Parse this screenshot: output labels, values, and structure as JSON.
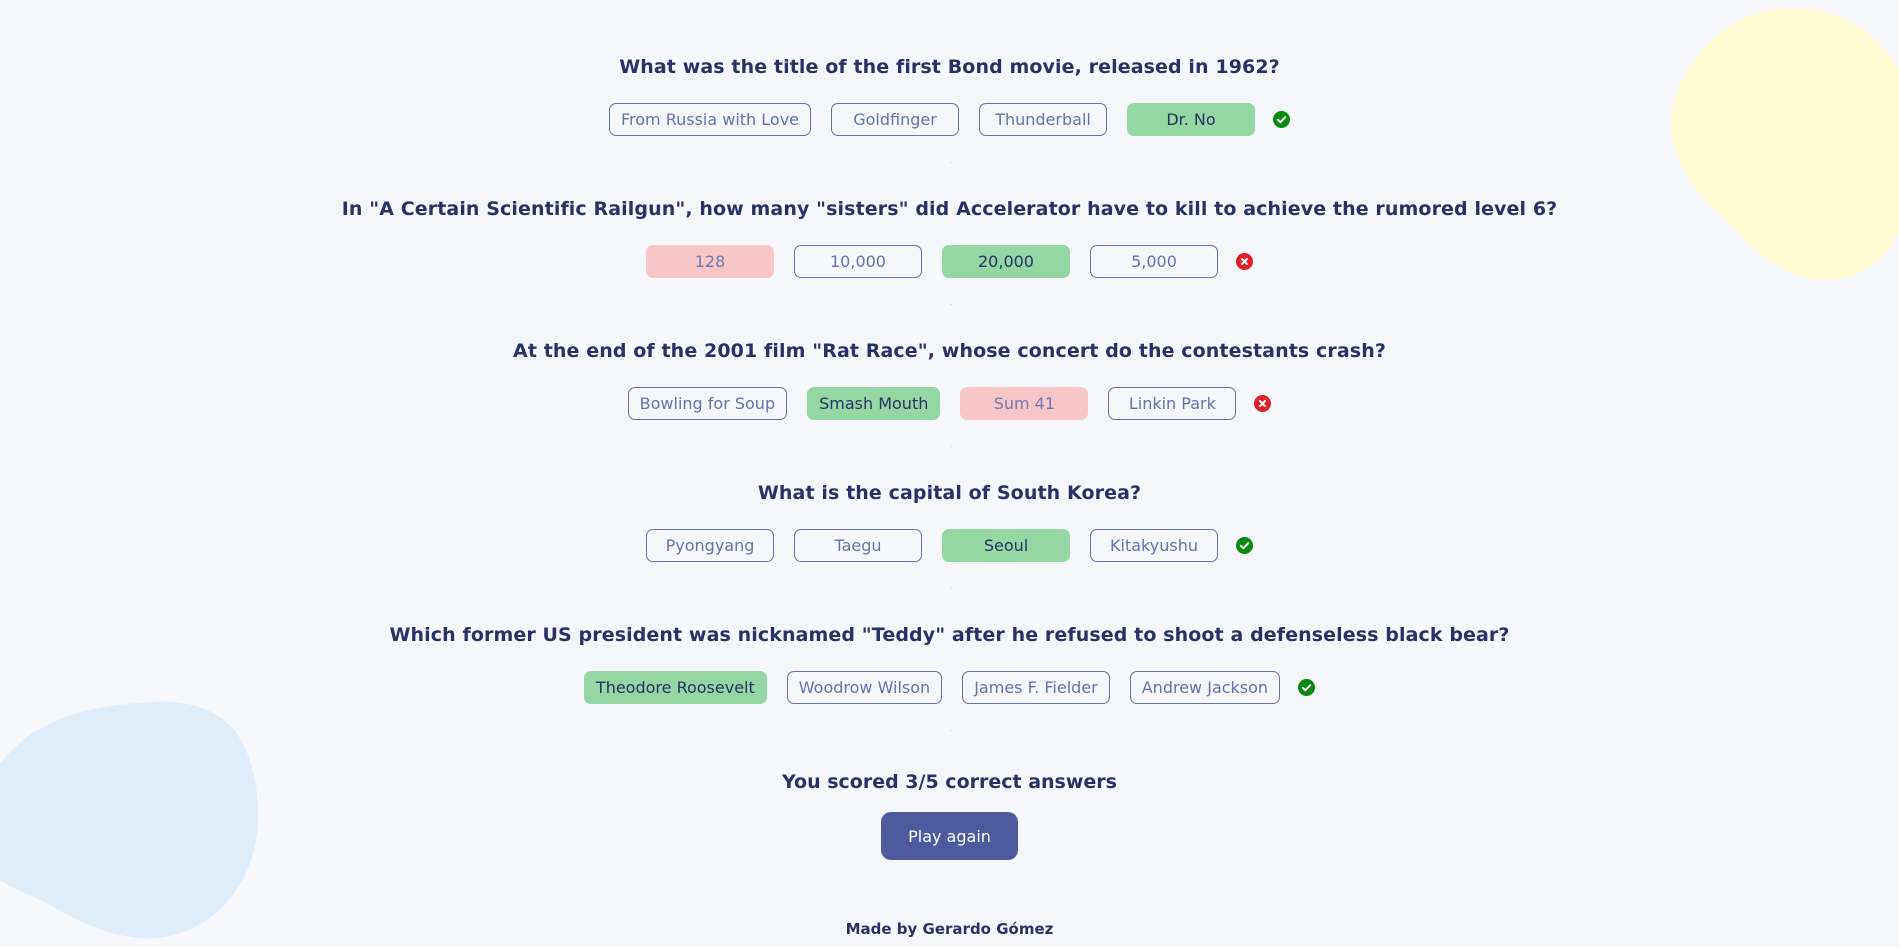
{
  "colors": {
    "background": "#f5f7fb",
    "text": "#293264",
    "answer_border": "#4d5b9e",
    "correct_fill": "#94d7a2",
    "wrong_fill": "#f8bcbc",
    "button": "#4d5b9e",
    "blob_yellow": "#fffad1",
    "blob_blue": "#deebf8",
    "icon_correct": "#0a8a10",
    "icon_wrong": "#e0202a"
  },
  "questions": [
    {
      "question": "What was the title of the first Bond movie, released in 1962?",
      "answers": [
        {
          "label": "From Russia with Love",
          "state": "neutral"
        },
        {
          "label": "Goldfinger",
          "state": "neutral"
        },
        {
          "label": "Thunderball",
          "state": "neutral"
        },
        {
          "label": "Dr. No",
          "state": "correct"
        }
      ],
      "result_icon": "check-circle-icon"
    },
    {
      "question": "In \"A Certain Scientific Railgun\", how many \"sisters\" did Accelerator have to kill to achieve the rumored level 6?",
      "answers": [
        {
          "label": "128",
          "state": "wrong"
        },
        {
          "label": "10,000",
          "state": "neutral"
        },
        {
          "label": "20,000",
          "state": "correct"
        },
        {
          "label": "5,000",
          "state": "neutral"
        }
      ],
      "result_icon": "x-circle-icon"
    },
    {
      "question": "At the end of the 2001 film \"Rat Race\", whose concert do the contestants crash?",
      "answers": [
        {
          "label": "Bowling for Soup",
          "state": "neutral"
        },
        {
          "label": "Smash Mouth",
          "state": "correct"
        },
        {
          "label": "Sum 41",
          "state": "wrong"
        },
        {
          "label": "Linkin Park",
          "state": "neutral"
        }
      ],
      "result_icon": "x-circle-icon"
    },
    {
      "question": "What is the capital of South Korea?",
      "answers": [
        {
          "label": "Pyongyang",
          "state": "neutral"
        },
        {
          "label": "Taegu",
          "state": "neutral"
        },
        {
          "label": "Seoul",
          "state": "correct"
        },
        {
          "label": "Kitakyushu",
          "state": "neutral"
        }
      ],
      "result_icon": "check-circle-icon"
    },
    {
      "question": "Which former US president was nicknamed \"Teddy\" after he refused to shoot a defenseless black bear?",
      "answers": [
        {
          "label": "Theodore Roosevelt",
          "state": "correct"
        },
        {
          "label": "Woodrow Wilson",
          "state": "neutral"
        },
        {
          "label": "James F. Fielder",
          "state": "neutral"
        },
        {
          "label": "Andrew Jackson",
          "state": "neutral"
        }
      ],
      "result_icon": "check-circle-icon"
    }
  ],
  "result": {
    "score_text": "You scored 3/5 correct answers",
    "play_again_label": "Play again"
  },
  "footer": {
    "credit": "Made by Gerardo Gómez"
  }
}
